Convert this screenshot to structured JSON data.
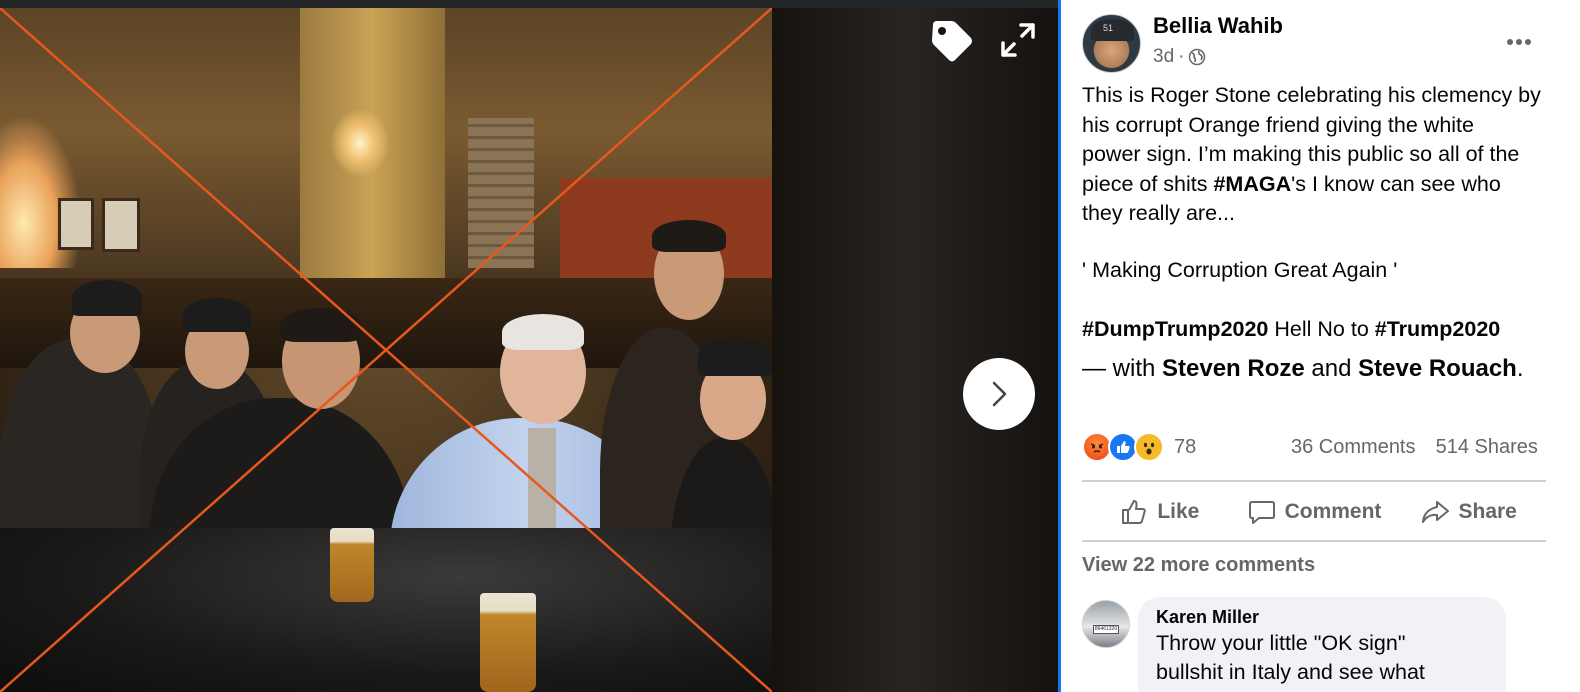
{
  "post": {
    "author": "Bellia Wahib",
    "time": "3d",
    "privacy_icon": "globe-icon",
    "more_icon": "more-options-icon",
    "text_lines": [
      "This is Roger Stone celebrating his clemency by",
      "his corrupt Orange friend giving the white",
      "power sign. I’m making this public so all of the",
      "piece of shits ",
      "#MAGA",
      "'s I know can see who",
      "they really are..."
    ],
    "quote": "' Making Corruption Great Again '",
    "hashtag1": "#DumpTrump2020",
    "mid_text": " Hell No to ",
    "hashtag2": "#Trump2020",
    "with_prefix": "— with ",
    "tagged1": "Steven Roze",
    "with_and": " and ",
    "tagged2": "Steve Rouach",
    "with_suffix": "."
  },
  "reactions": {
    "icons": [
      "angry-icon",
      "like-icon",
      "wow-icon"
    ],
    "count": "78",
    "comments": "36 Comments",
    "shares": "514 Shares"
  },
  "actions": {
    "like": "Like",
    "comment": "Comment",
    "share": "Share"
  },
  "comments": {
    "view_more": "View 22 more comments",
    "first": {
      "name": "Karen Miller",
      "text_line1": "Throw your little \"OK sign\"",
      "text_line2": "bullshit in Italy and see what"
    }
  },
  "viewer": {
    "tag_icon": "tag-icon",
    "expand_icon": "expand-icon",
    "next_icon": "chevron-right-icon",
    "cap_text": "51",
    "plate_text": "86461320"
  },
  "colors": {
    "accent": "#1877f2",
    "x_overlay": "#e8581c",
    "secondary_text": "#65676b"
  }
}
